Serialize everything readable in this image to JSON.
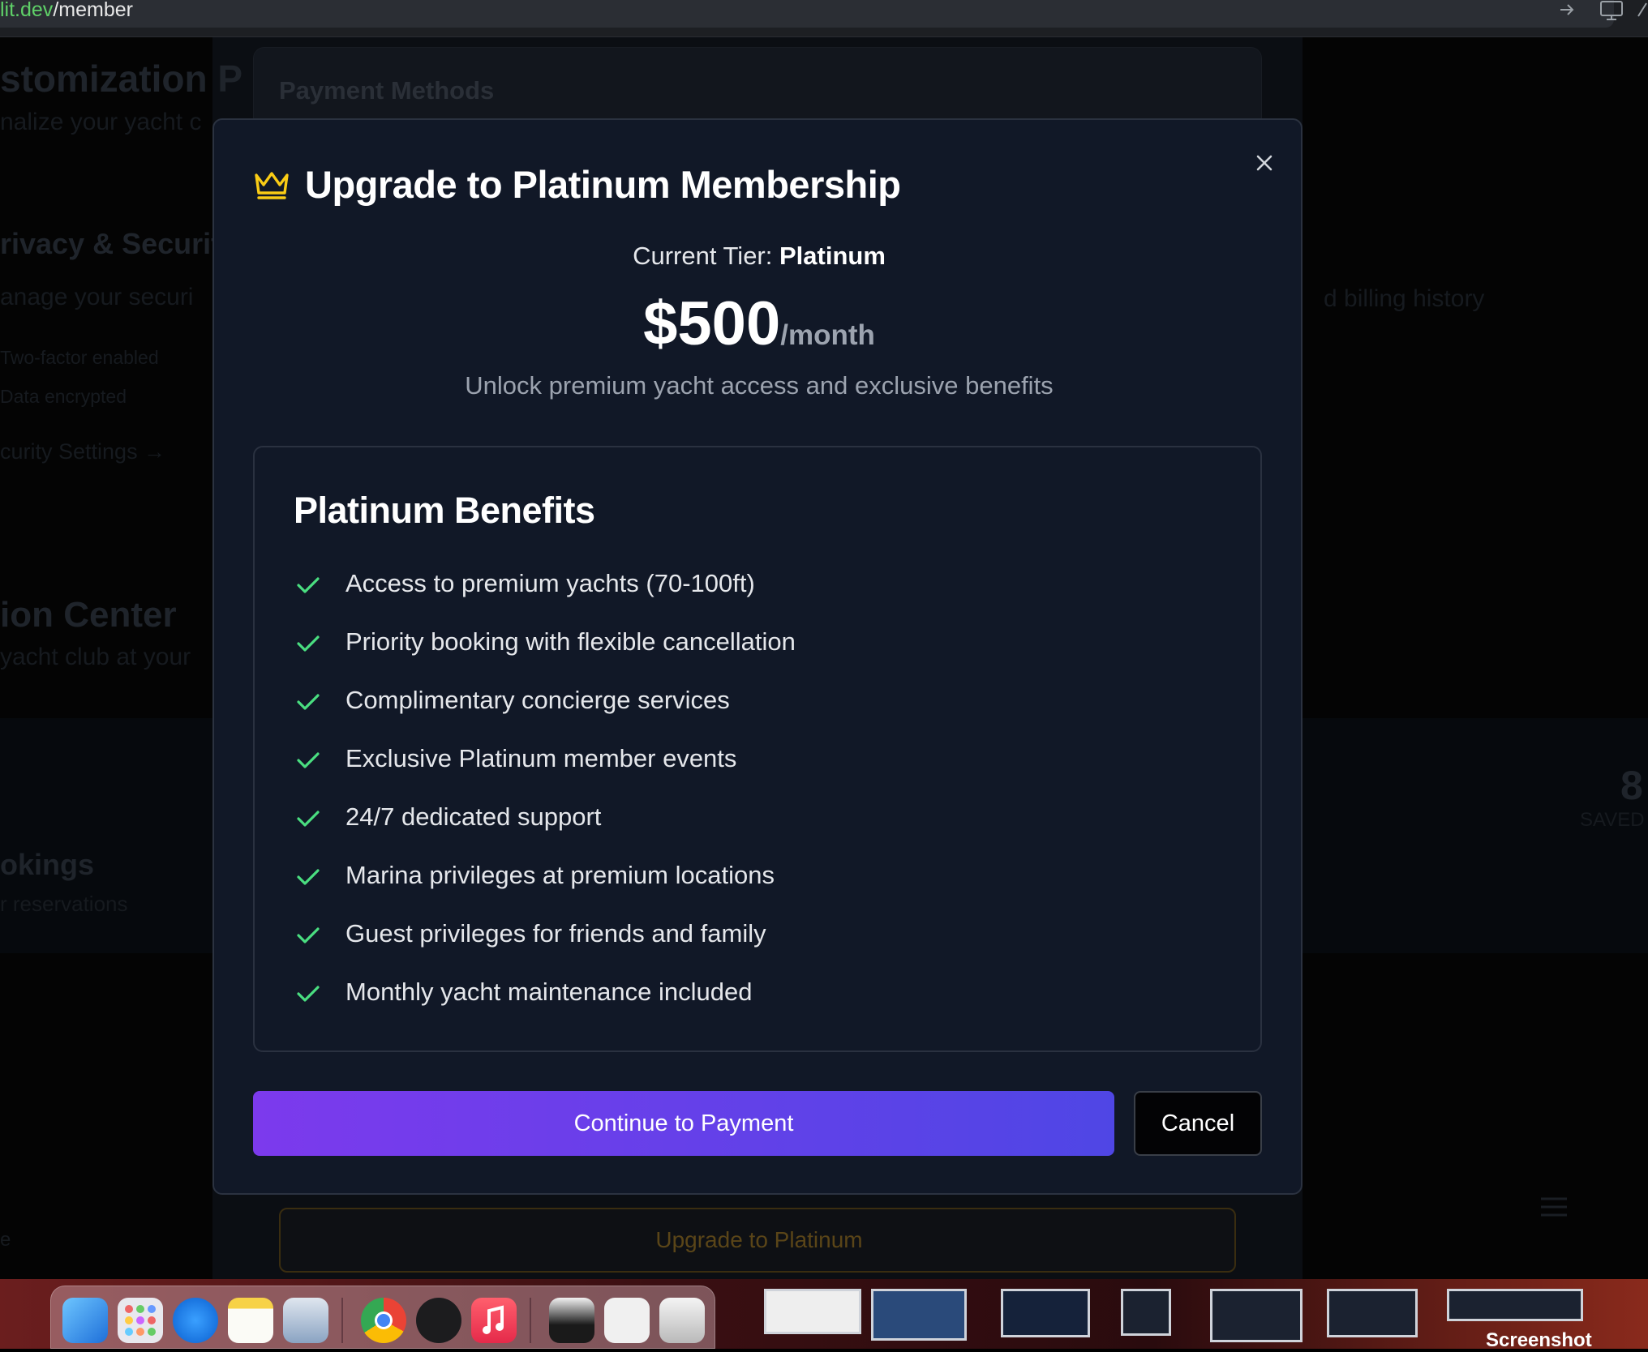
{
  "browser": {
    "url_domain": "lit.dev",
    "url_path": "/member"
  },
  "background": {
    "headings": [
      "stomization P",
      "rivacy & Securit",
      "ion Center",
      "okings"
    ],
    "subtexts": [
      "nalize your yacht c",
      "anage your securi",
      "yacht club at your",
      "r reservations"
    ],
    "security_items": [
      "Two-factor enabled",
      "Data encrypted"
    ],
    "security_link": "curity Settings →",
    "billing_text": "d billing history",
    "stat_value": "8",
    "stat_label": "SAVED",
    "card_title": "Payment Methods",
    "upgrade_button": "Upgrade to Platinum",
    "sidebar_fragment": "e"
  },
  "modal": {
    "title": "Upgrade to Platinum Membership",
    "current_tier_label": "Current Tier:",
    "current_tier_value": "Platinum",
    "price": "$500",
    "price_period": "/month",
    "subtitle": "Unlock premium yacht access and exclusive benefits",
    "benefits_title": "Platinum Benefits",
    "benefits": [
      "Access to premium yachts (70-100ft)",
      "Priority booking with flexible cancellation",
      "Complimentary concierge services",
      "Exclusive Platinum member events",
      "24/7 dedicated support",
      "Marina privileges at premium locations",
      "Guest privileges for friends and family",
      "Monthly yacht maintenance included"
    ],
    "continue_label": "Continue to Payment",
    "cancel_label": "Cancel"
  },
  "dock": {
    "apps": [
      "finder-icon",
      "launchpad-icon",
      "safari-icon",
      "notes-icon",
      "preview-icon",
      "chrome-icon",
      "activity-icon",
      "music-icon",
      "screen-icon",
      "keyboard-icon",
      "trash-icon"
    ],
    "screenshot_label": "Screenshot"
  },
  "colors": {
    "accent_check": "#4ade80",
    "crown": "#facc15",
    "gradient_start": "#7c3aed",
    "gradient_end": "#4f46e5"
  }
}
